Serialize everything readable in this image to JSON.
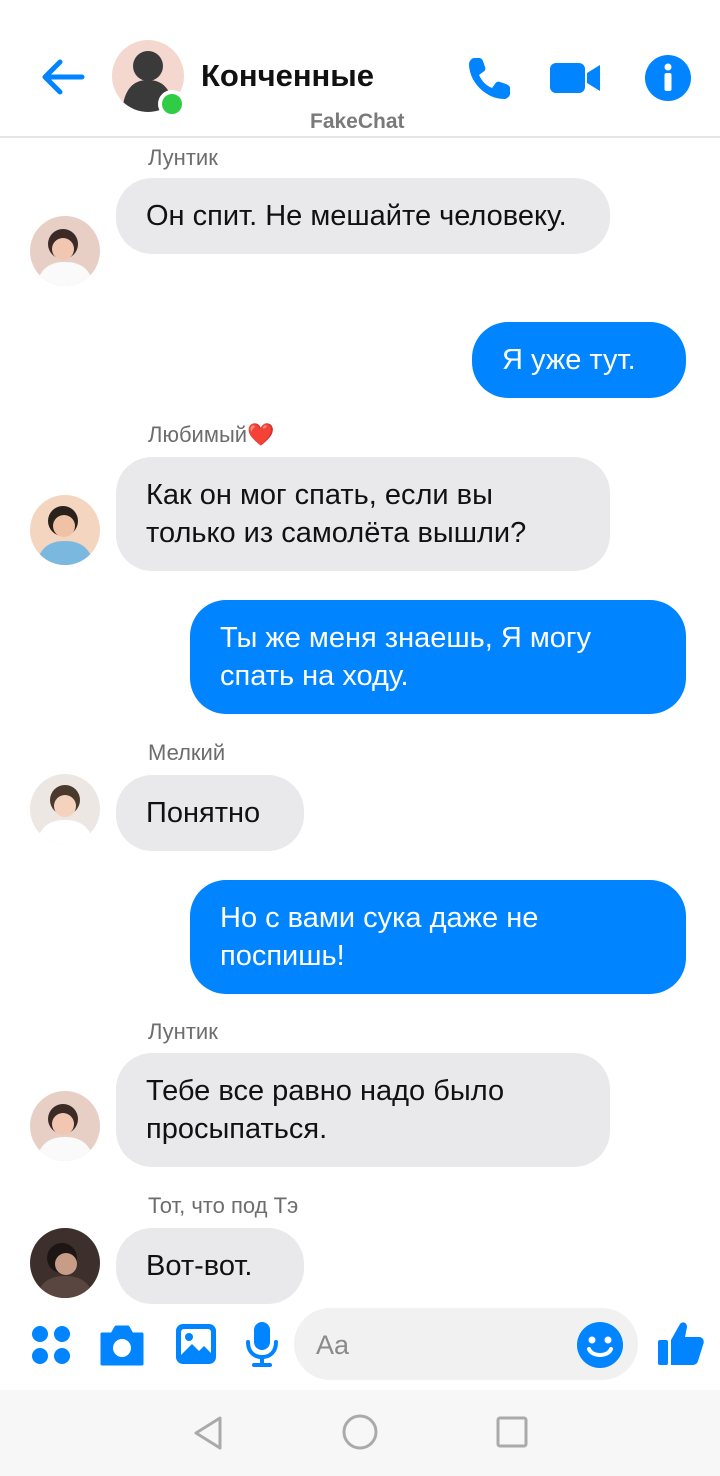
{
  "header": {
    "title": "Конченные",
    "watermark": "FakeChat",
    "icons": [
      "back-arrow-icon",
      "phone-icon",
      "video-camera-icon",
      "info-icon"
    ],
    "online": true
  },
  "colors": {
    "accent": "#0084ff",
    "incoming_bubble": "#e9e9eb",
    "online": "#31cc46"
  },
  "messages": [
    {
      "direction": "in",
      "sender": "Лунтик",
      "text": "Он спит. Не мешайте человеку."
    },
    {
      "direction": "out",
      "text": "Я уже тут."
    },
    {
      "direction": "in",
      "sender": "Любимый❤️",
      "text": "Как он мог спать, если вы только из самолёта вышли?"
    },
    {
      "direction": "out",
      "text": "Ты же меня знаешь, Я могу спать на ходу."
    },
    {
      "direction": "in",
      "sender": "Мелкий",
      "text": "Понятно"
    },
    {
      "direction": "out",
      "text": "Но с вами сука даже не поспишь!"
    },
    {
      "direction": "in",
      "sender": "Лунтик",
      "text": "Тебе все равно надо было просыпаться."
    },
    {
      "direction": "in",
      "sender": "Тот, что под Тэ",
      "text": "Вот-вот."
    }
  ],
  "composer": {
    "placeholder": "Aa",
    "icons": [
      "apps-grid-icon",
      "camera-icon",
      "gallery-icon",
      "microphone-icon",
      "emoji-icon",
      "thumbs-up-icon"
    ]
  },
  "navbar": {
    "icons": [
      "back-triangle-icon",
      "home-circle-icon",
      "recents-square-icon"
    ]
  }
}
